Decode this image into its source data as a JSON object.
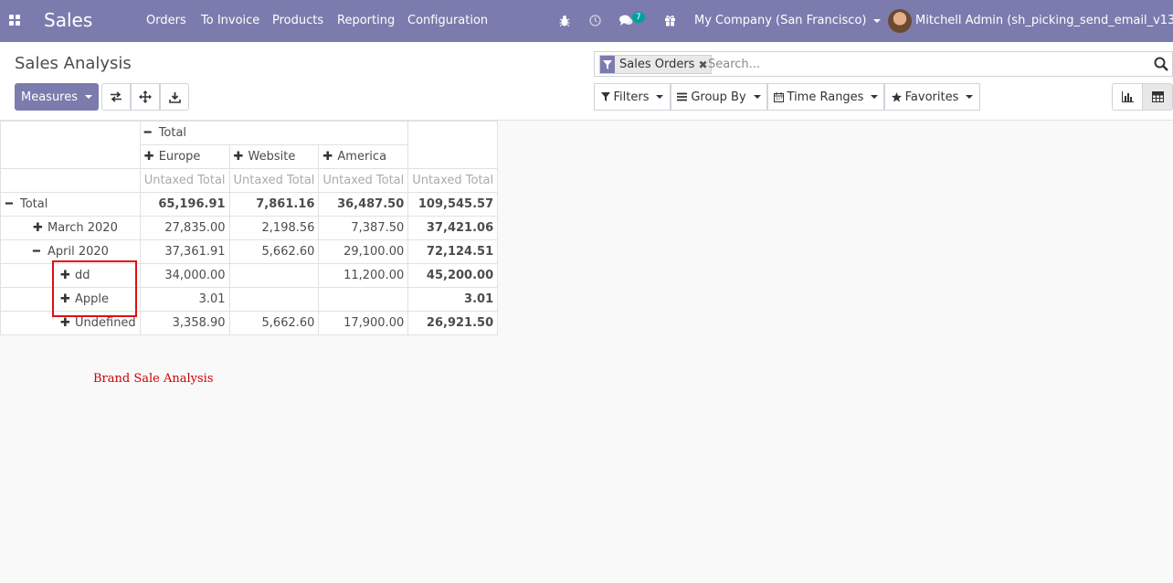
{
  "navbar": {
    "app_name": "Sales",
    "menu": [
      "Orders",
      "To Invoice",
      "Products",
      "Reporting",
      "Configuration"
    ],
    "messages_count": "7",
    "company": "My Company (San Francisco)",
    "user": "Mitchell Admin (sh_picking_send_email_v13c)",
    "icons": [
      "apps-icon",
      "bug-icon",
      "clock-icon",
      "chat-icon",
      "gift-icon"
    ]
  },
  "control_panel": {
    "title": "Sales Analysis",
    "measures_label": "Measures",
    "search_facet": "Sales Orders",
    "search_placeholder": "Search...",
    "filters_label": "Filters",
    "groupby_label": "Group By",
    "timeranges_label": "Time Ranges",
    "favorites_label": "Favorites"
  },
  "pivot": {
    "col_total": "Total",
    "columns": [
      "Europe",
      "Website",
      "America"
    ],
    "measure": "Untaxed Total",
    "rows": [
      {
        "label": "Total",
        "values": [
          "65,196.91",
          "7,861.16",
          "36,487.50",
          "109,545.57"
        ]
      },
      {
        "label": "March 2020",
        "values": [
          "27,835.00",
          "2,198.56",
          "7,387.50",
          "37,421.06"
        ]
      },
      {
        "label": "April 2020",
        "values": [
          "37,361.91",
          "5,662.60",
          "29,100.00",
          "72,124.51"
        ]
      },
      {
        "label": "dd",
        "values": [
          "34,000.00",
          "",
          "11,200.00",
          "45,200.00"
        ]
      },
      {
        "label": "Apple",
        "values": [
          "3.01",
          "",
          "",
          "3.01"
        ]
      },
      {
        "label": "Undefined",
        "values": [
          "3,358.90",
          "5,662.60",
          "17,900.00",
          "26,921.50"
        ]
      }
    ]
  },
  "annotation": {
    "caption": "Brand Sale Analysis",
    "color": "#e01010"
  },
  "colors": {
    "navbar": "#7c7bad",
    "badge": "#00a09d"
  }
}
